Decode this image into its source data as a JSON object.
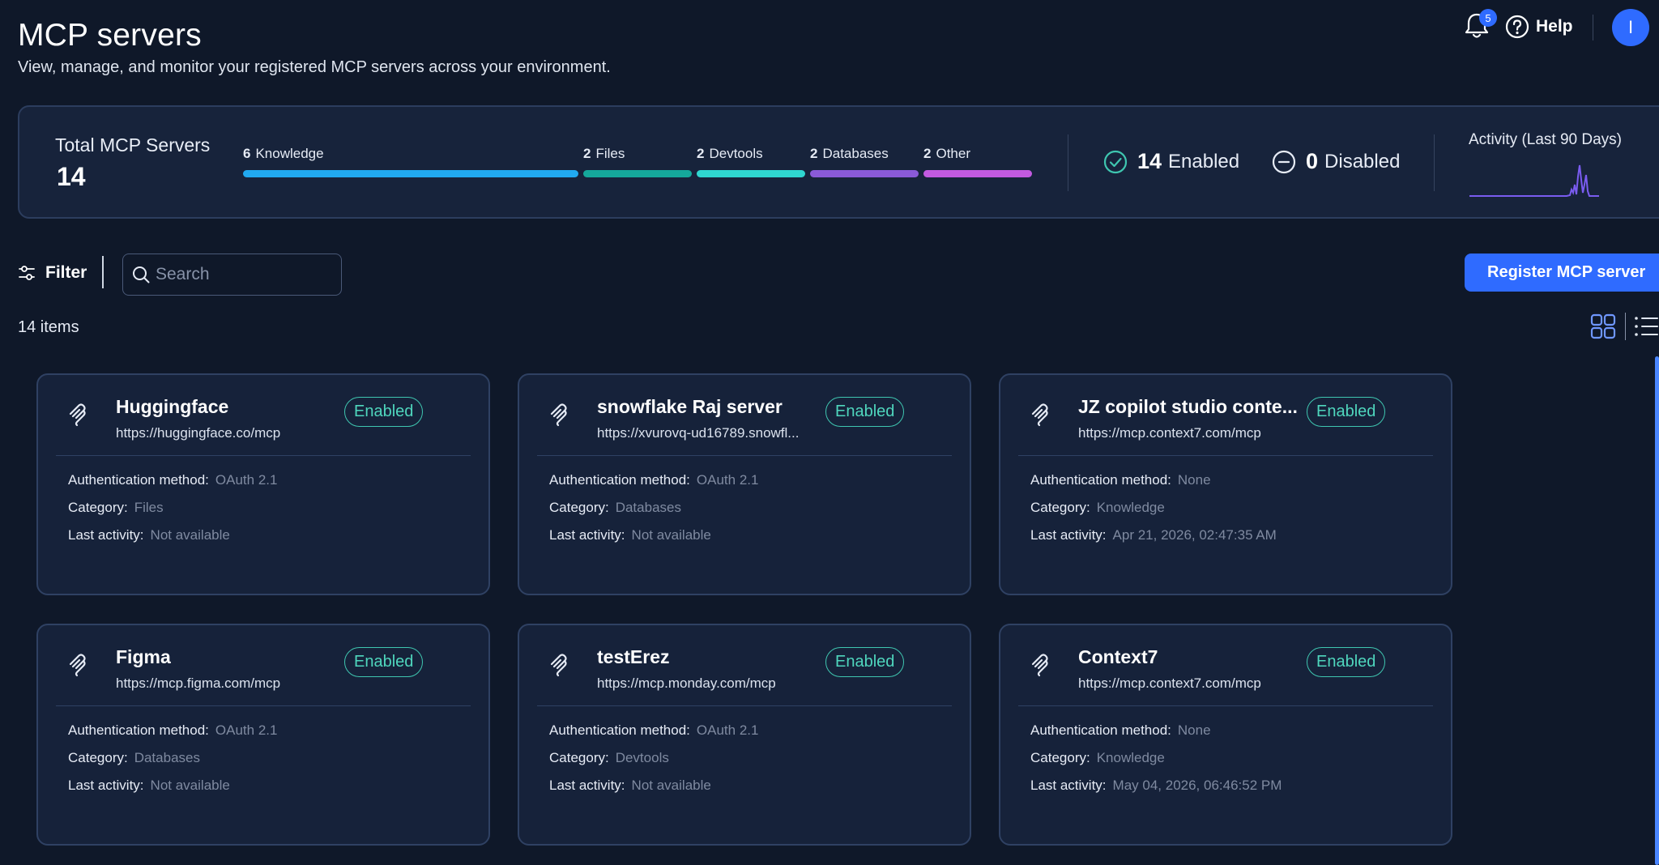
{
  "header": {
    "title": "MCP servers",
    "subtitle": "View, manage, and monitor your registered MCP servers across your environment.",
    "notification_count": "5",
    "help_label": "Help",
    "avatar_initial": "I"
  },
  "summary": {
    "total_label": "Total MCP Servers",
    "total_value": "14",
    "categories": [
      {
        "count": "6",
        "label": "Knowledge",
        "value": 6,
        "color": "#21a9f0"
      },
      {
        "count": "2",
        "label": "Files",
        "value": 2,
        "color": "#15a89b"
      },
      {
        "count": "2",
        "label": "Devtools",
        "value": 2,
        "color": "#2fd6d0"
      },
      {
        "count": "2",
        "label": "Databases",
        "value": 2,
        "color": "#8a5ad8"
      },
      {
        "count": "2",
        "label": "Other",
        "value": 2,
        "color": "#c25ae0"
      }
    ],
    "enabled_count": "14",
    "enabled_label": "Enabled",
    "disabled_count": "0",
    "disabled_label": "Disabled",
    "activity_title": "Activity (Last 90 Days)",
    "activity_color": "#7a5cf0"
  },
  "toolbar": {
    "filter_label": "Filter",
    "search_placeholder": "Search",
    "register_label": "Register MCP server",
    "items_count": "14 items"
  },
  "labels": {
    "auth": "Authentication method:",
    "category": "Category:",
    "last_activity": "Last activity:"
  },
  "cards": [
    {
      "name": "Huggingface",
      "url": "https://huggingface.co/mcp",
      "status": "Enabled",
      "auth": "OAuth 2.1",
      "category": "Files",
      "last_activity": "Not available"
    },
    {
      "name": "snowflake Raj server",
      "url": "https://xvurovq-ud16789.snowfl...",
      "status": "Enabled",
      "auth": "OAuth 2.1",
      "category": "Databases",
      "last_activity": "Not available"
    },
    {
      "name": "JZ copilot studio conte...",
      "url": "https://mcp.context7.com/mcp",
      "status": "Enabled",
      "auth": "None",
      "category": "Knowledge",
      "last_activity": "Apr 21, 2026, 02:47:35 AM"
    },
    {
      "name": "Figma",
      "url": "https://mcp.figma.com/mcp",
      "status": "Enabled",
      "auth": "OAuth 2.1",
      "category": "Databases",
      "last_activity": "Not available"
    },
    {
      "name": "testErez",
      "url": "https://mcp.monday.com/mcp",
      "status": "Enabled",
      "auth": "OAuth 2.1",
      "category": "Devtools",
      "last_activity": "Not available"
    },
    {
      "name": "Context7",
      "url": "https://mcp.context7.com/mcp",
      "status": "Enabled",
      "auth": "None",
      "category": "Knowledge",
      "last_activity": "May 04, 2026, 06:46:52 PM"
    }
  ]
}
